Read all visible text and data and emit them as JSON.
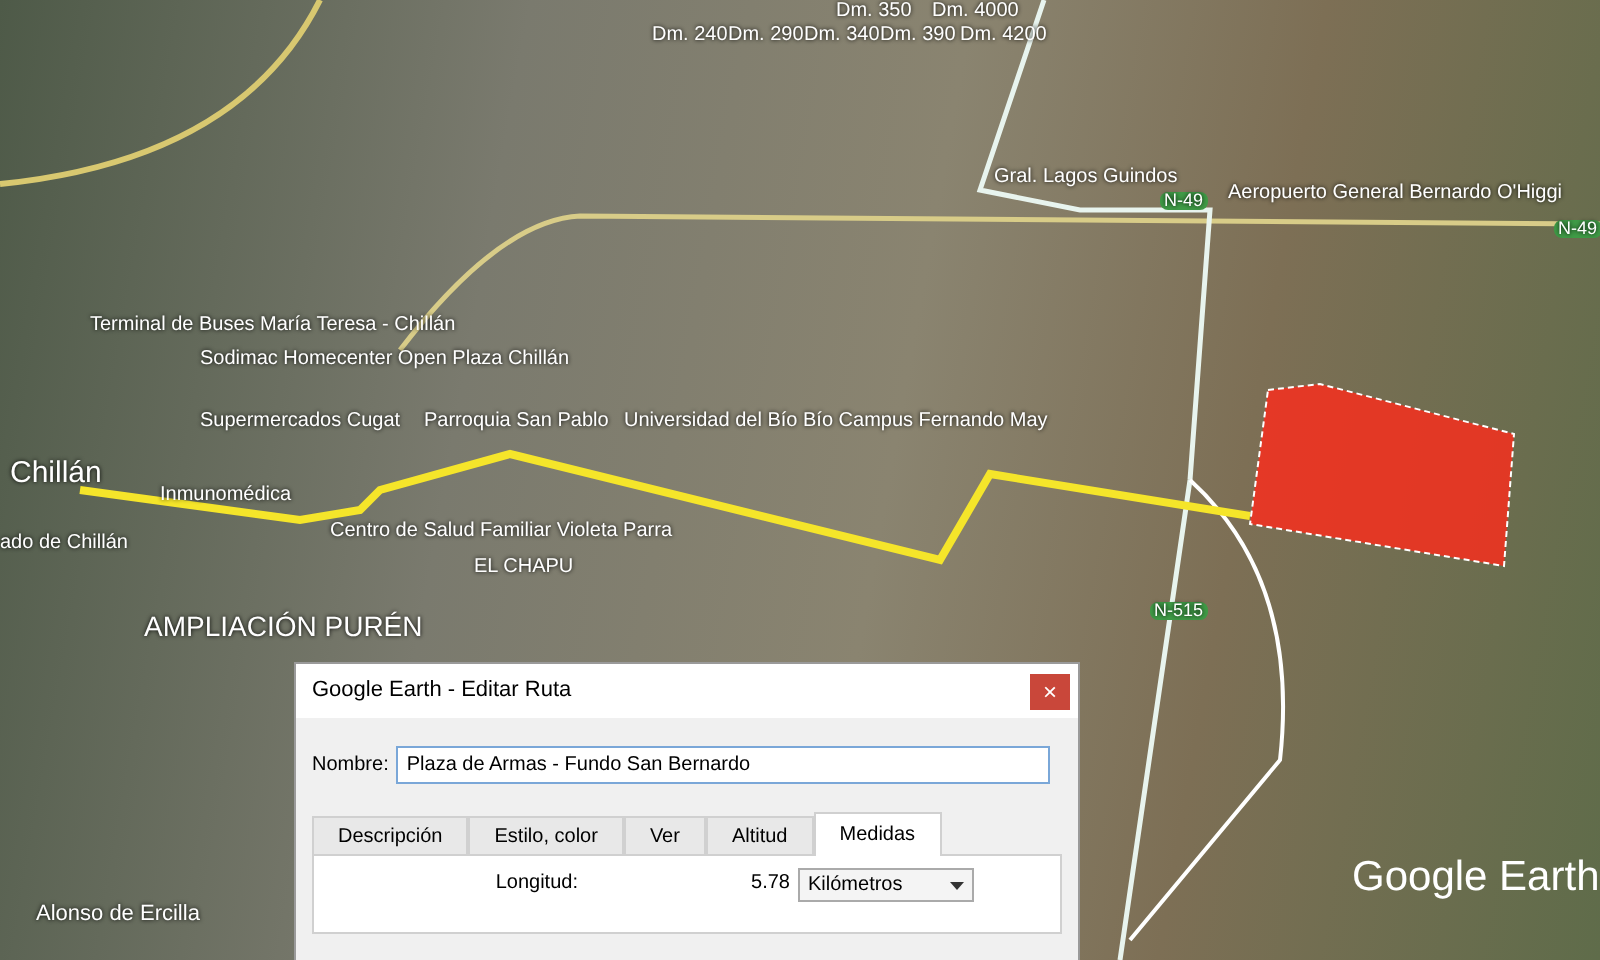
{
  "map": {
    "labels": [
      {
        "kind": "measure",
        "text": "Dm. 350"
      },
      {
        "kind": "measure",
        "text": "Dm. 4000"
      },
      {
        "kind": "measure",
        "text": "Dm. 240"
      },
      {
        "kind": "measure",
        "text": "Dm. 290"
      },
      {
        "kind": "measure",
        "text": "Dm. 340"
      },
      {
        "kind": "measure",
        "text": "Dm. 390"
      },
      {
        "kind": "measure",
        "text": "Dm. 4200"
      },
      {
        "kind": "poi",
        "text": "Terminal de Buses María Teresa - Chillán"
      },
      {
        "kind": "poi",
        "text": "Sodimac Homecenter Open Plaza Chillán"
      },
      {
        "kind": "poi",
        "text": "Supermercados Cugat"
      },
      {
        "kind": "poi",
        "text": "Parroquia San Pablo"
      },
      {
        "kind": "poi",
        "text": "Universidad del Bío Bío Campus Fernando May"
      },
      {
        "kind": "city",
        "text": "Chillán"
      },
      {
        "kind": "poi",
        "text": "Inmunomédica"
      },
      {
        "kind": "poi",
        "text": "ado de Chillán"
      },
      {
        "kind": "poi",
        "text": "Centro de Salud Familiar Violeta Parra"
      },
      {
        "kind": "poi",
        "text": "EL CHAPU"
      },
      {
        "kind": "district",
        "text": "AMPLIACIÓN PURÉN"
      },
      {
        "kind": "street",
        "text": "Alonso de Ercilla"
      },
      {
        "kind": "poi",
        "text": "Gral. Lagos Guindos"
      },
      {
        "kind": "shield",
        "text": "N-49"
      },
      {
        "kind": "poi",
        "text": "Aeropuerto General Bernardo O'Higgi"
      },
      {
        "kind": "shield",
        "text": "N-49"
      },
      {
        "kind": "shield",
        "text": "N-515"
      }
    ],
    "logo": "Google Earth"
  },
  "dialog": {
    "title": "Google Earth - Editar Ruta",
    "close": "×",
    "name_label": "Nombre:",
    "name_value": "Plaza de Armas - Fundo San Bernardo",
    "tabs": [
      {
        "label": "Descripción",
        "selected": false
      },
      {
        "label": "Estilo, color",
        "selected": false
      },
      {
        "label": "Ver",
        "selected": false
      },
      {
        "label": "Altitud",
        "selected": false
      },
      {
        "label": "Medidas",
        "selected": true
      }
    ],
    "length_label": "Longitud:",
    "length_value": "5.78",
    "unit": "Kilómetros"
  }
}
